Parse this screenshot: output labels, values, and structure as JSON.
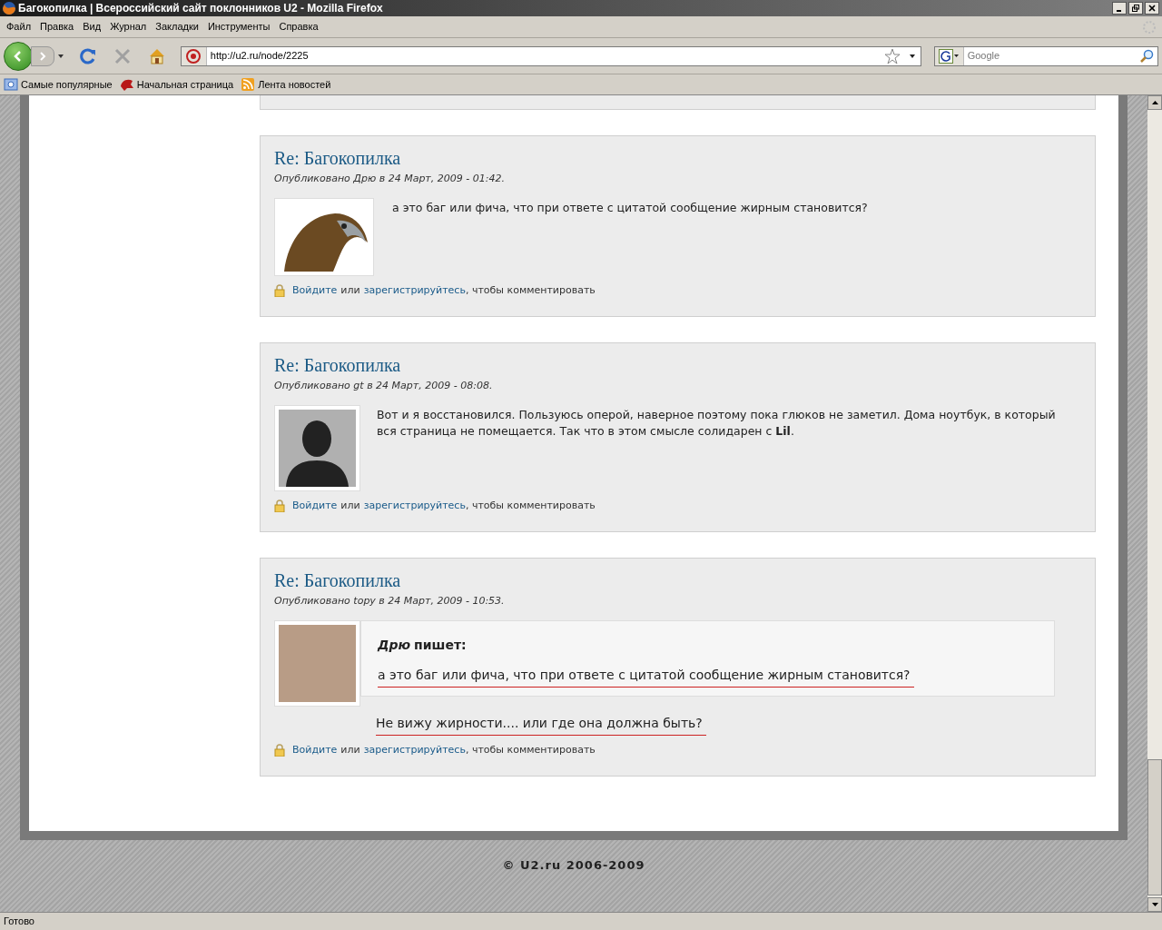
{
  "window": {
    "title": "Багокопилка | Всероссийский сайт поклонников U2 - Mozilla Firefox"
  },
  "menu": [
    "Файл",
    "Правка",
    "Вид",
    "Журнал",
    "Закладки",
    "Инструменты",
    "Справка"
  ],
  "address": {
    "value": "http://u2.ru/node/2225"
  },
  "search": {
    "placeholder": "Google"
  },
  "bookmarks": [
    {
      "label": "Самые популярные",
      "kind": "magnifier"
    },
    {
      "label": "Начальная страница",
      "kind": "firefox"
    },
    {
      "label": "Лента новостей",
      "kind": "feed"
    }
  ],
  "comments": [
    {
      "title": "Re: Багокопилка",
      "meta": "Опубликовано Дрю в 24 Март, 2009 - 01:42.",
      "avatar": {
        "kind": "eagle"
      },
      "kind": "plain",
      "body": "а это баг или фича, что при ответе с цитатой сообщение жирным становится?",
      "login": "Войдите",
      "or": "или",
      "register": "зарегистрируйтесь",
      "tail": ", чтобы комментировать"
    },
    {
      "title": "Re: Багокопилка",
      "meta": "Опубликовано gt в 24 Март, 2009 - 08:08.",
      "avatar": {
        "kind": "silhouette"
      },
      "kind": "plain",
      "body": "Вот и я восстановился. Пользуюсь оперой, наверное поэтому пока глюков не заметил. Дома ноутбук, в который вся страница не помещается. Так что в этом смысле солидарен с **Lil**.",
      "login": "Войдите",
      "or": "или",
      "register": "зарегистрируйтесь",
      "tail": ", чтобы комментировать"
    },
    {
      "title": "Re: Багокопилка",
      "meta": "Опубликовано topy в 24 Март, 2009 - 10:53.",
      "avatar": {
        "kind": "photo"
      },
      "kind": "quote",
      "quote_author": "Дрю",
      "quote_says": "пишет:",
      "quote": "а это баг или фича, что при ответе с цитатой сообщение жирным становится?",
      "body": "Не вижу жирности.... или где она должна быть?",
      "login": "Войдите",
      "or": "или",
      "register": "зарегистрируйтесь",
      "tail": ", чтобы комментировать"
    }
  ],
  "footer": "© U2.ru 2006-2009",
  "status_bar": "Готово"
}
